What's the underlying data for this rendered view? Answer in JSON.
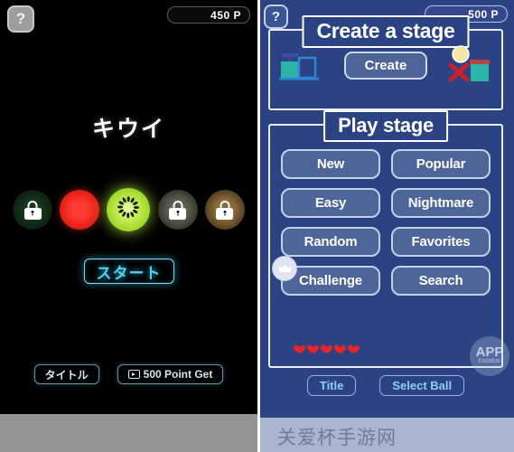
{
  "left_panel": {
    "help_label": "?",
    "points_badge": "450 P",
    "ball_title": "キウイ",
    "balls": [
      {
        "name": "locked-slot-1",
        "state": "locked",
        "kind": "locked-green"
      },
      {
        "name": "watermelon-ball",
        "state": "unlocked",
        "kind": "watermelon"
      },
      {
        "name": "kiwi-ball",
        "state": "selected",
        "kind": "kiwi"
      },
      {
        "name": "locked-slot-4",
        "state": "locked",
        "kind": "locked-gray"
      },
      {
        "name": "locked-slot-5",
        "state": "locked",
        "kind": "locked-brown"
      }
    ],
    "start_label": "スタート",
    "title_label": "タイトル",
    "point_get_label": "500 Point Get"
  },
  "right_panel": {
    "help_label": "?",
    "points_badge": "500 P",
    "create_section": {
      "heading": "Create a stage",
      "create_label": "Create"
    },
    "play_section": {
      "heading": "Play stage",
      "buttons": [
        {
          "label": "New",
          "badge": null
        },
        {
          "label": "Popular",
          "badge": null
        },
        {
          "label": "Easy",
          "badge": null
        },
        {
          "label": "Nightmare",
          "badge": null
        },
        {
          "label": "Random",
          "badge": null
        },
        {
          "label": "Favorites",
          "badge": null
        },
        {
          "label": "Challenge",
          "badge": "crown-icon"
        },
        {
          "label": "Search",
          "badge": null
        }
      ],
      "hearts_count": 5
    },
    "footer_buttons": [
      {
        "label": "Title"
      },
      {
        "label": "Select Ball"
      }
    ],
    "app_watermark": {
      "line1": "APP",
      "line2": "bailabai"
    },
    "bottom_watermark": "关爱杯手游网"
  },
  "colors": {
    "left_bg": "#000000",
    "right_bg": "#2b4382",
    "accent_cyan": "#49d4f4",
    "button_blue": "#4e6599",
    "heart_red": "#e8232a",
    "kiwi_green": "#9ed82a",
    "watermelon_red": "#ff3b30"
  }
}
